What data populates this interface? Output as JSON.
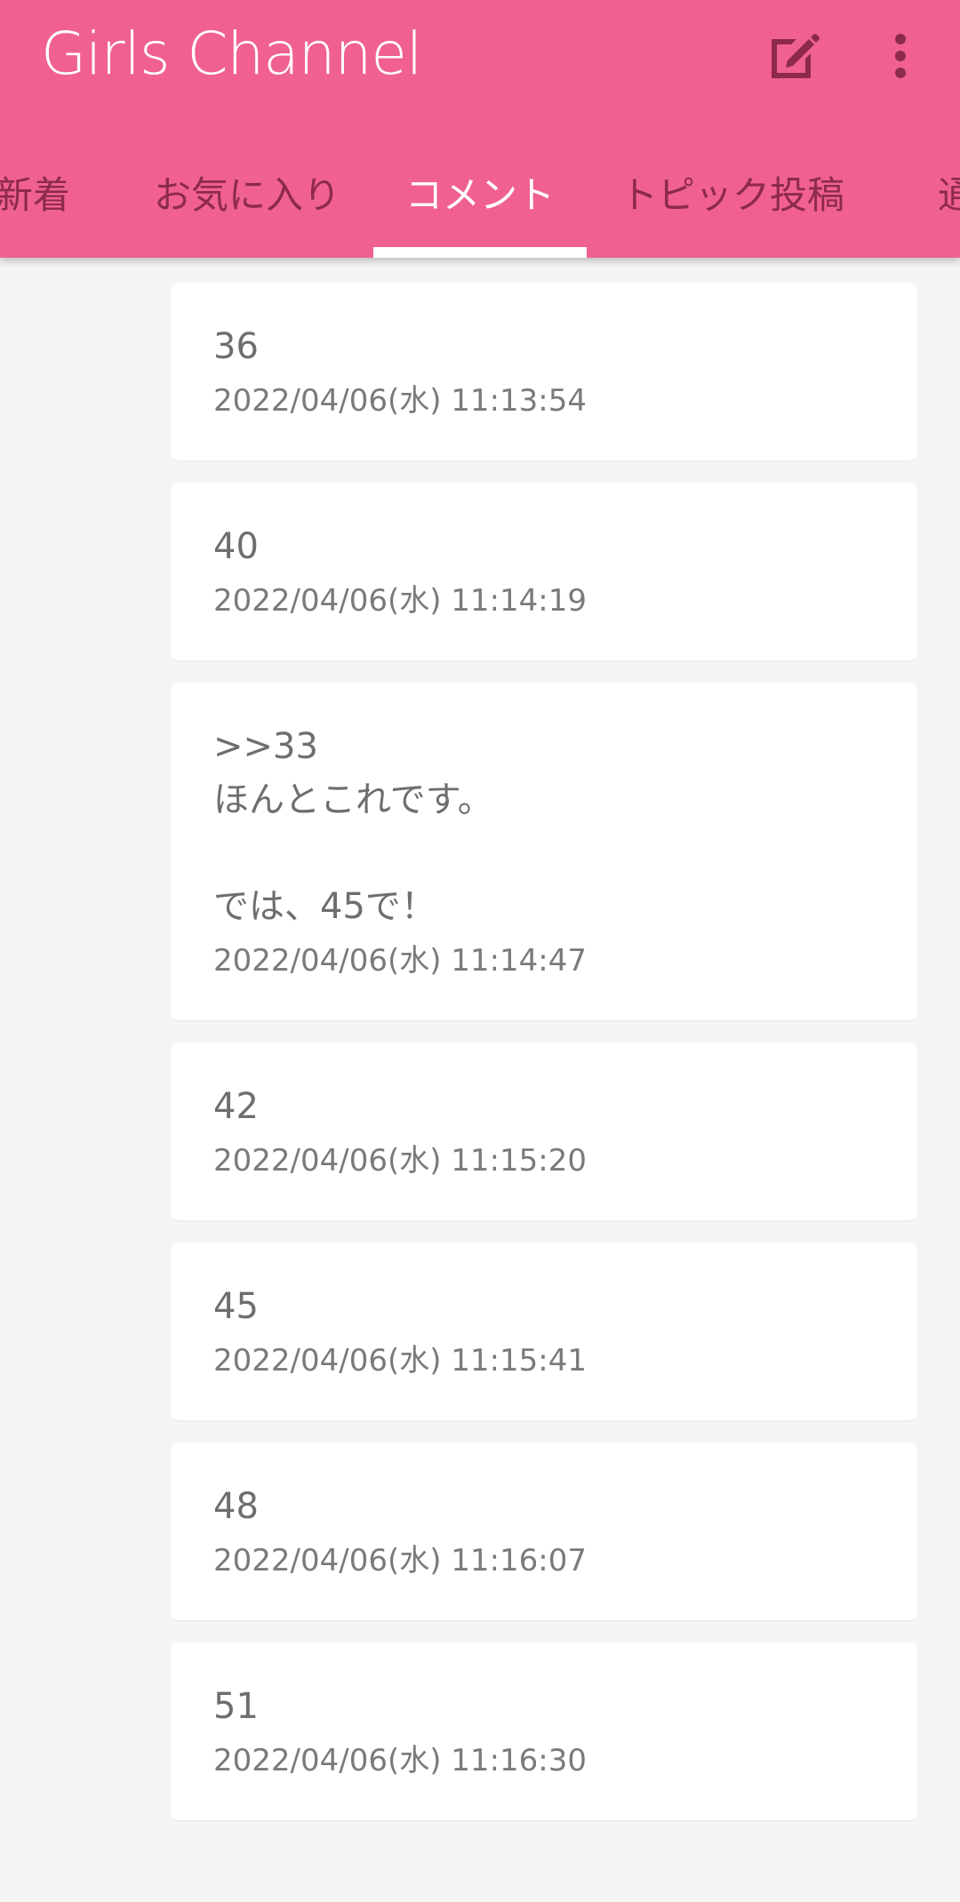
{
  "app": {
    "title": "Girls Channel",
    "colors": {
      "primary": "#f06190",
      "tab_inactive": "#8d2a4c",
      "tab_active": "#ffffff",
      "icon": "#8d2a4c",
      "background": "#f5f5f5"
    }
  },
  "toolbar": {
    "edit_icon": "edit-icon",
    "more_icon": "more-vert-icon"
  },
  "tabs": [
    {
      "label": "新着"
    },
    {
      "label": "お気に入り"
    },
    {
      "label": "コメント",
      "active": true
    },
    {
      "label": "トピック投稿"
    },
    {
      "label": "通"
    }
  ],
  "comments": [
    {
      "body": "36",
      "time": "2022/04/06(水) 11:13:54"
    },
    {
      "body": "40",
      "time": "2022/04/06(水) 11:14:19"
    },
    {
      "body": ">>33\nほんとこれです。\n\nでは、45で！",
      "time": "2022/04/06(水) 11:14:47"
    },
    {
      "body": "42",
      "time": "2022/04/06(水) 11:15:20"
    },
    {
      "body": "45",
      "time": "2022/04/06(水) 11:15:41"
    },
    {
      "body": "48",
      "time": "2022/04/06(水) 11:16:07"
    },
    {
      "body": "51",
      "time": "2022/04/06(水) 11:16:30"
    }
  ]
}
